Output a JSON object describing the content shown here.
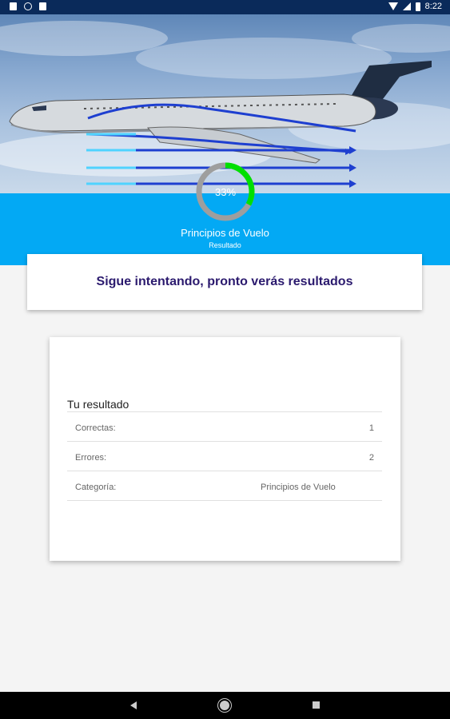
{
  "status_bar": {
    "time": "8:22"
  },
  "header": {
    "progress_percent": 33,
    "progress_label": "33%",
    "category_title": "Principios de Vuelo",
    "category_subtitle": "Resultado"
  },
  "message": {
    "text": "Sigue intentando, pronto verás resultados"
  },
  "result": {
    "title": "Tu resultado",
    "rows": [
      {
        "label": "Correctas:",
        "value": "1"
      },
      {
        "label": "Errores:",
        "value": "2"
      },
      {
        "label": "Categoría:",
        "value": "Principios de Vuelo"
      }
    ]
  },
  "colors": {
    "accent_blue": "#03a9f4",
    "progress_green": "#00e000",
    "progress_track": "#9e9e9e",
    "message_text": "#2b1a6e"
  }
}
